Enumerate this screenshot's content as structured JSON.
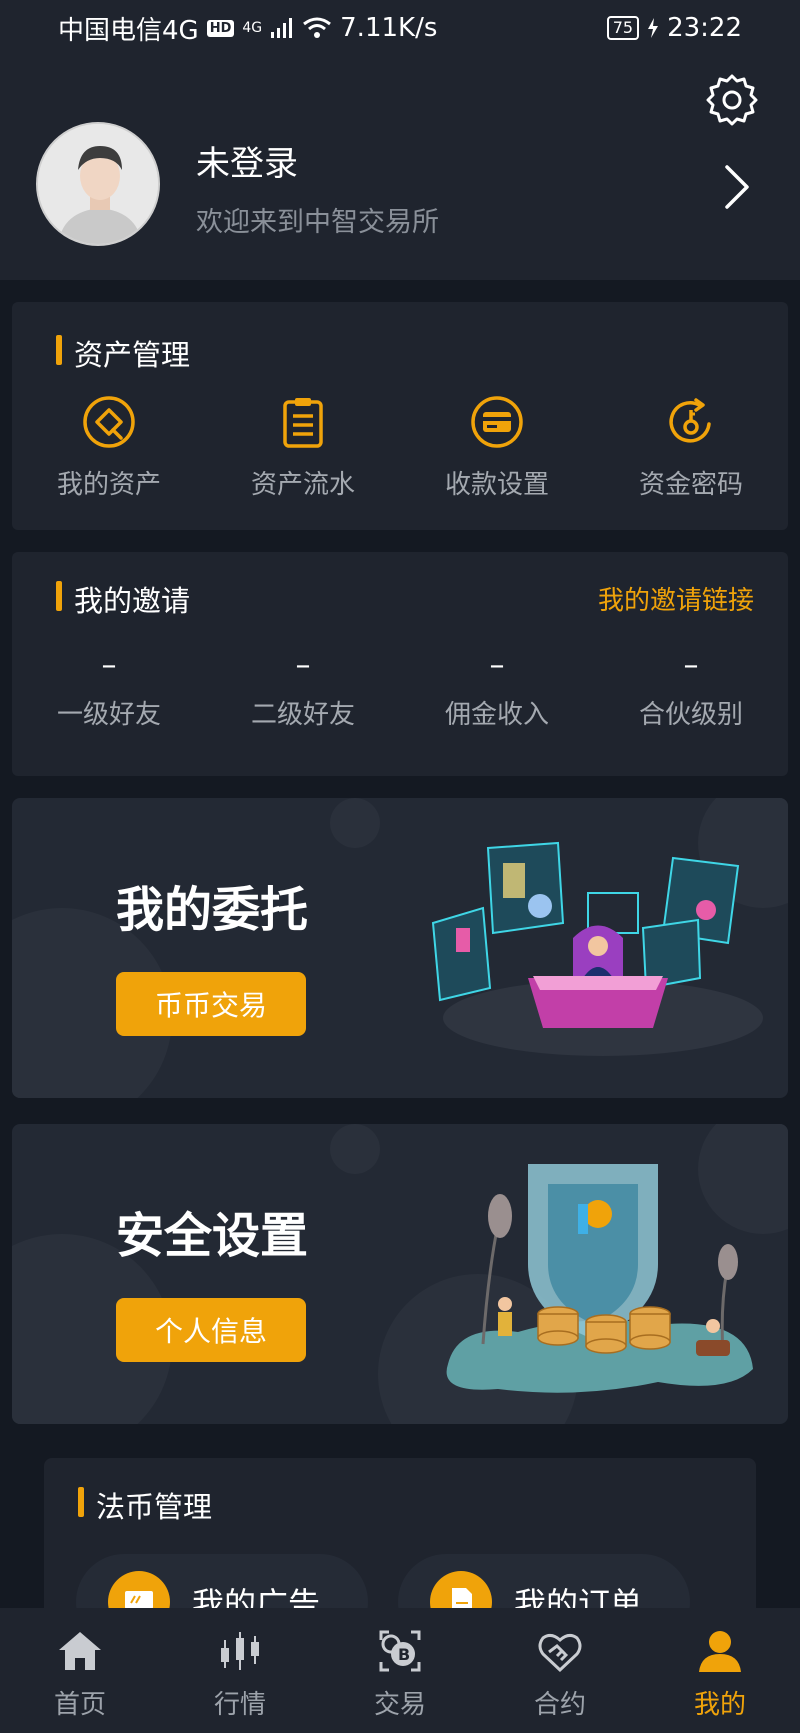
{
  "status_bar": {
    "carrier": "中国电信4G",
    "hd": "HD",
    "network": "4G",
    "speed": "7.11K/s",
    "battery": "75",
    "time": "23:22"
  },
  "profile": {
    "name": "未登录",
    "welcome": "欢迎来到中智交易所",
    "settings_icon": "gear-icon",
    "chevron_icon": "chevron-right-icon"
  },
  "assets": {
    "title": "资产管理",
    "items": [
      {
        "label": "我的资产",
        "icon": "assets-icon"
      },
      {
        "label": "资产流水",
        "icon": "clipboard-icon"
      },
      {
        "label": "收款设置",
        "icon": "card-icon"
      },
      {
        "label": "资金密码",
        "icon": "key-lock-icon"
      }
    ]
  },
  "invite": {
    "title": "我的邀请",
    "link_label": "我的邀请链接",
    "stats": [
      {
        "value": "–",
        "label": "一级好友"
      },
      {
        "value": "–",
        "label": "二级好友"
      },
      {
        "value": "–",
        "label": "佣金收入"
      },
      {
        "value": "–",
        "label": "合伙级别"
      }
    ]
  },
  "banners": {
    "entrust": {
      "title": "我的委托",
      "button": "币币交易"
    },
    "security": {
      "title": "安全设置",
      "button": "个人信息"
    }
  },
  "fiat": {
    "title": "法币管理",
    "items": [
      {
        "label": "我的广告",
        "icon": "ad-screen-icon"
      },
      {
        "label": "我的订单",
        "icon": "document-icon"
      }
    ]
  },
  "nav": {
    "items": [
      {
        "label": "首页",
        "icon": "home-icon"
      },
      {
        "label": "行情",
        "icon": "candlestick-icon"
      },
      {
        "label": "交易",
        "icon": "bitcoin-exchange-icon"
      },
      {
        "label": "合约",
        "icon": "handshake-icon"
      },
      {
        "label": "我的",
        "icon": "user-icon"
      }
    ],
    "active": "我的"
  },
  "colors": {
    "accent": "#f0a30a",
    "background": "#141922",
    "card": "#1f242e"
  }
}
